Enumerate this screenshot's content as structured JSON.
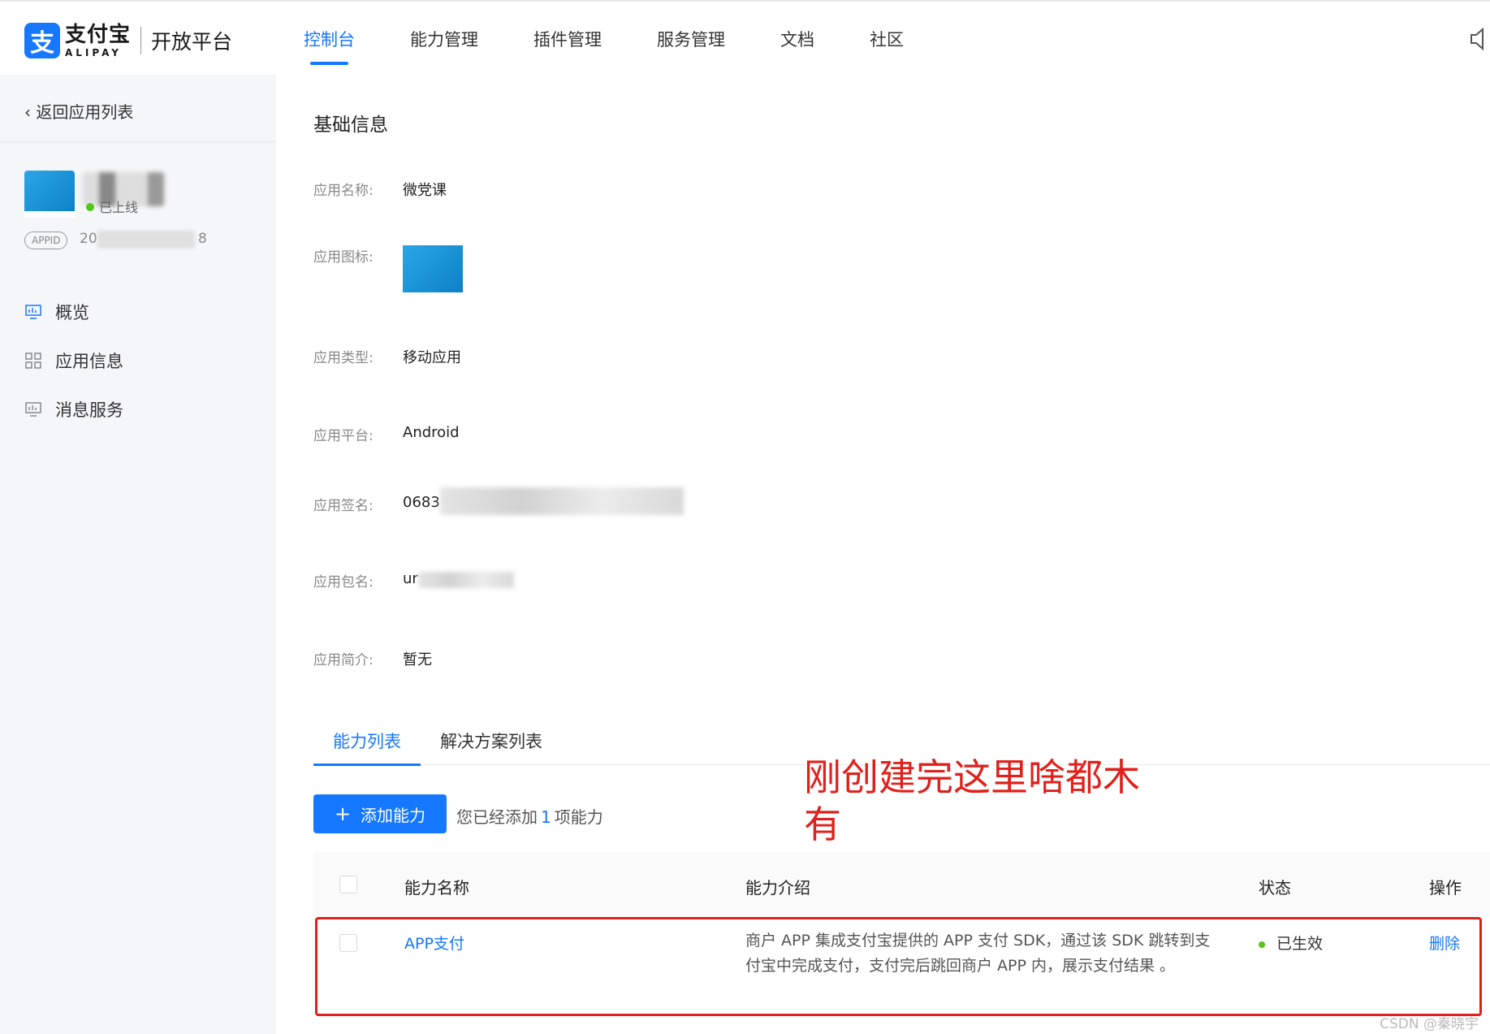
{
  "header": {
    "logo_mark": "支",
    "logo_cn": "支付宝",
    "logo_en": "ALIPAY",
    "platform": "开放平台",
    "nav": [
      "控制台",
      "能力管理",
      "插件管理",
      "服务管理",
      "文档",
      "社区"
    ]
  },
  "sidebar": {
    "back": "返回应用列表",
    "app_status": "已上线",
    "appid_label": "APPID",
    "appid_prefix": "20",
    "appid_suffix": "8",
    "menu": [
      "概览",
      "应用信息",
      "消息服务"
    ]
  },
  "basic": {
    "title": "基础信息",
    "fields": [
      {
        "label": "应用名称:",
        "value": "微党课"
      },
      {
        "label": "应用图标:",
        "value": ""
      },
      {
        "label": "应用类型:",
        "value": "移动应用"
      },
      {
        "label": "应用平台:",
        "value": "Android"
      },
      {
        "label": "应用签名:",
        "value": "0683"
      },
      {
        "label": "应用包名:",
        "value": "ur"
      },
      {
        "label": "应用简介:",
        "value": "暂无"
      }
    ]
  },
  "tabs": [
    "能力列表",
    "解决方案列表"
  ],
  "toolbar": {
    "add_label": "添加能力",
    "tip_prefix": "您已经添加",
    "tip_count": "1",
    "tip_suffix": "项能力"
  },
  "table": {
    "headers": [
      "能力名称",
      "能力介绍",
      "状态",
      "操作"
    ],
    "rows": [
      {
        "name": "APP支付",
        "desc": "商户 APP 集成支付宝提供的 APP 支付 SDK，通过该 SDK 跳转到支付宝中完成支付，支付完后跳回商户 APP 内，展示支付结果 。",
        "status": "已生效",
        "action": "删除"
      }
    ]
  },
  "annotation": "刚创建完这里啥都木有",
  "watermark": "CSDN @秦晓宇",
  "colors": {
    "accent": "#1677ff",
    "annotation": "#e0201b",
    "online": "#52c41a"
  }
}
